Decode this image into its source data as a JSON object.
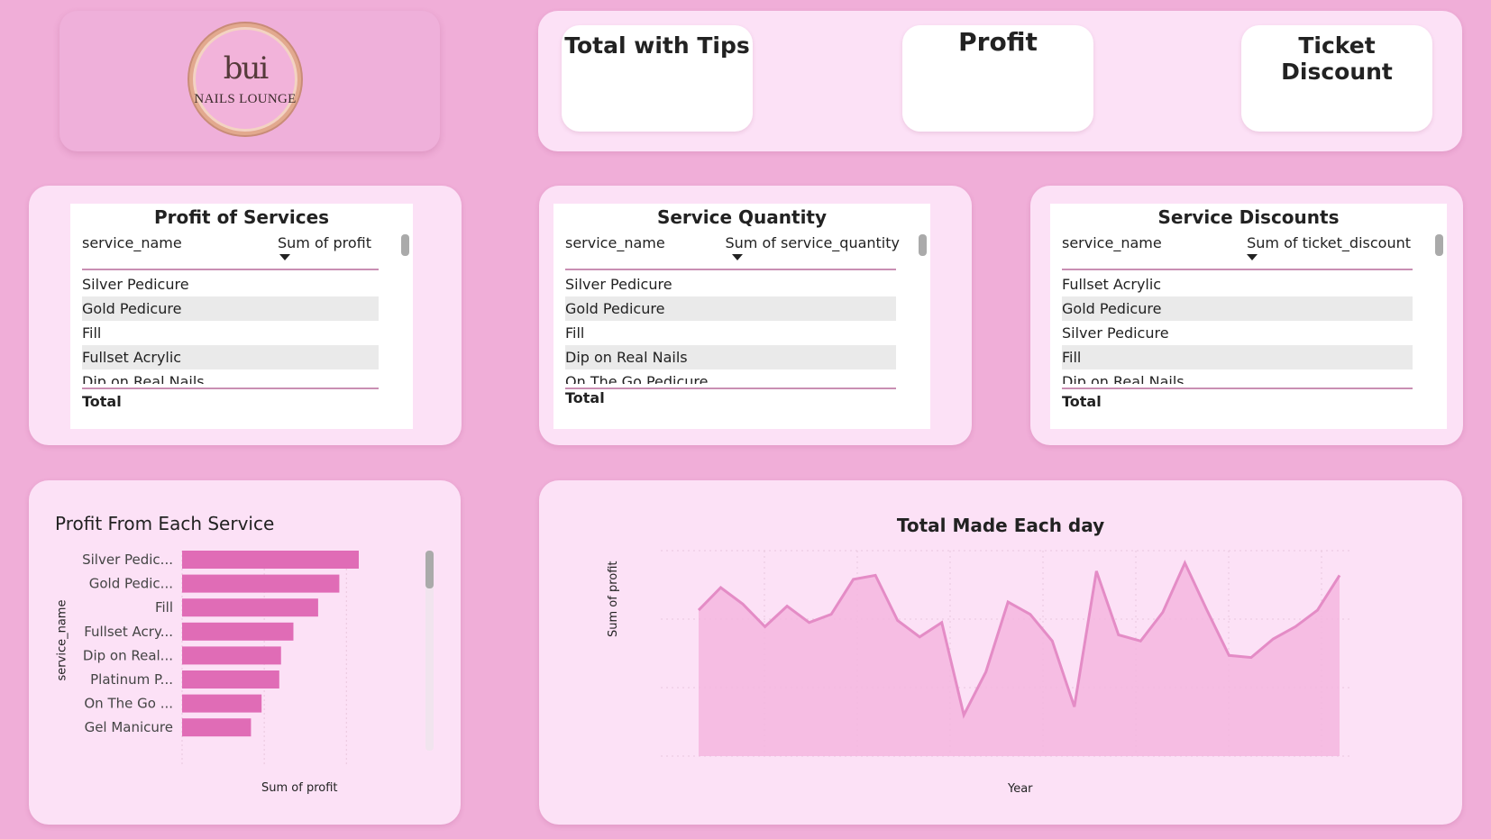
{
  "logo": {
    "mark": "bui",
    "brand": "NAILS LOUNGE"
  },
  "kpis": [
    {
      "title": "Total with Tips"
    },
    {
      "title": "Profit"
    },
    {
      "title": "Ticket Discount"
    }
  ],
  "tables": [
    {
      "title": "Profit of Services",
      "col1": "service_name",
      "col2": "Sum of profit",
      "rows": [
        "Silver Pedicure",
        "Gold Pedicure",
        "Fill",
        "Fullset Acrylic",
        "Dip on Real Nails"
      ],
      "total": "Total"
    },
    {
      "title": "Service Quantity",
      "col1": "service_name",
      "col2": "Sum of service_quantity",
      "rows": [
        "Silver Pedicure",
        "Gold Pedicure",
        "Fill",
        "Dip on Real Nails",
        "On The Go Pedicure"
      ],
      "total": "Total"
    },
    {
      "title": "Service Discounts",
      "col1": "service_name",
      "col2": "Sum of ticket_discount",
      "rows": [
        "Fullset Acrylic",
        "Gold Pedicure",
        "Silver Pedicure",
        "Fill",
        "Dip on Real Nails"
      ],
      "total": "Total"
    }
  ],
  "charts": {
    "bar_title": "Profit From Each Service",
    "bar_xlabel": "Sum of profit",
    "bar_ylabel": "service_name",
    "line_title": "Total Made Each day",
    "line_xlabel": "Year",
    "line_ylabel": "Sum of profit"
  },
  "colors": {
    "background": "#f0aed8",
    "panel": "#fce1f6",
    "bar": "#e06cb6",
    "line": "#e48cc6",
    "area": "#f5b6df"
  },
  "chart_data": [
    {
      "type": "bar",
      "orientation": "horizontal",
      "categories": [
        "Silver Pedic...",
        "Gold Pedic...",
        "Fill",
        "Fullset Acry...",
        "Dip on Real...",
        "Platinum P...",
        "On The Go ...",
        "Gel Manicure"
      ],
      "values": [
        100,
        89,
        77,
        63,
        56,
        55,
        45,
        39
      ]
    },
    {
      "type": "area",
      "values": [
        71,
        82,
        74,
        63,
        73,
        65,
        69,
        86,
        88,
        66,
        58,
        65,
        20,
        41,
        75,
        69,
        56,
        24,
        90,
        59,
        56,
        70,
        94,
        71,
        49,
        48,
        57,
        63,
        71,
        88
      ]
    }
  ]
}
